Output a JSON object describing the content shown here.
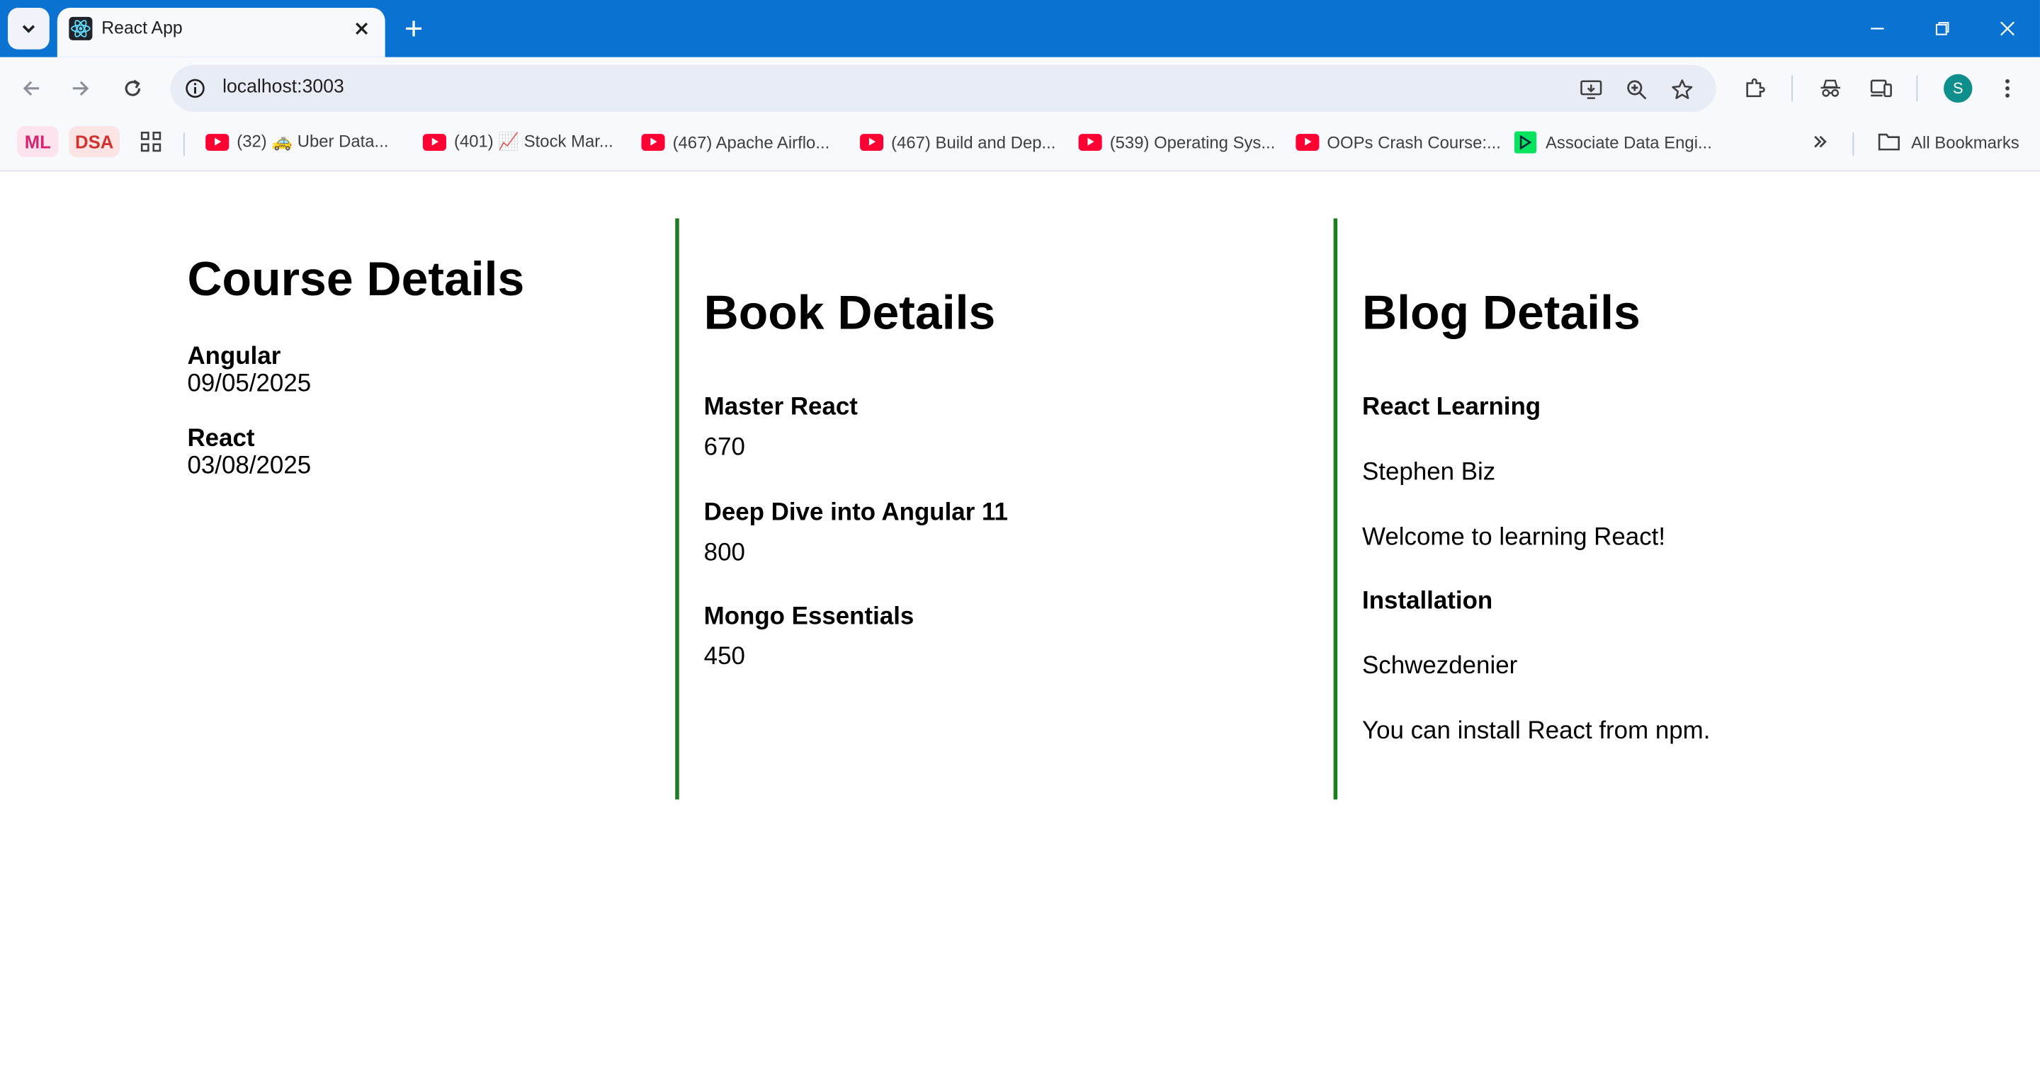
{
  "browser": {
    "tab_title": "React App",
    "url": "localhost:3003",
    "profile_initial": "S",
    "bookmarks": {
      "ml": "ML",
      "dsa": "DSA",
      "items": [
        "(32) 🚕 Uber Data...",
        "(401) 📈 Stock Mar...",
        "(467) Apache Airflo...",
        "(467) Build and Dep...",
        "(539) Operating Sys...",
        "OOPs Crash Course:...",
        "Associate Data Engi..."
      ],
      "all_bookmarks": "All Bookmarks"
    }
  },
  "course": {
    "title": "Course Details",
    "items": [
      {
        "name": "Angular",
        "date": "09/05/2025"
      },
      {
        "name": "React",
        "date": "03/08/2025"
      }
    ]
  },
  "book": {
    "title": "Book Details",
    "items": [
      {
        "name": "Master React",
        "price": "670"
      },
      {
        "name": "Deep Dive into Angular 11",
        "price": "800"
      },
      {
        "name": "Mongo Essentials",
        "price": "450"
      }
    ]
  },
  "blog": {
    "title": "Blog Details",
    "items": [
      {
        "title": "React Learning",
        "author": "Stephen Biz",
        "body": "Welcome to learning React!"
      },
      {
        "title": "Installation",
        "author": "Schwezdenier",
        "body": "You can install React from npm."
      }
    ]
  },
  "colors": {
    "divider": "#1a7f1a",
    "tabstrip": "#0a73d1"
  }
}
